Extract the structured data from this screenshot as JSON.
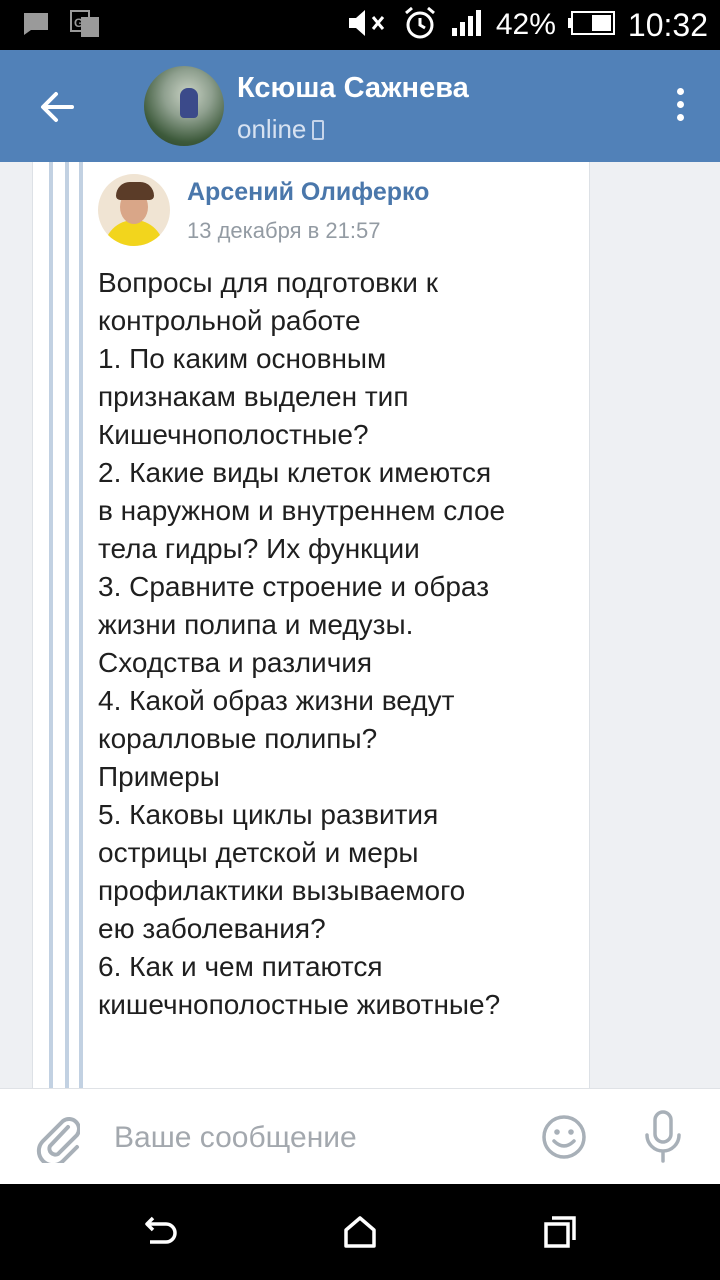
{
  "status_bar": {
    "battery_percent": "42%",
    "time": "10:32",
    "icons": [
      "message-icon",
      "translate-icon",
      "mute-icon",
      "alarm-icon",
      "signal-icon",
      "battery-icon"
    ]
  },
  "header": {
    "contact_name": "Ксюша Сажнева",
    "status": "online",
    "icons": [
      "back-arrow-icon",
      "mobile-icon",
      "more-vert-icon"
    ]
  },
  "forwarded_message": {
    "author": "Арсений Олиферко",
    "date": "13 декабря в 21:57",
    "lines": [
      "Вопросы для подготовки к",
      "контрольной работе",
      "1. По каким основным",
      "признакам выделен тип",
      "Кишечнополостные?",
      "2. Какие виды клеток имеются",
      "в наружном и внутреннем слое",
      "тела гидры? Их функции",
      "3. Сравните строение и образ",
      "жизни полипа и медузы.",
      "Сходства и различия",
      "4. Какой образ жизни ведут",
      "коралловые полипы?",
      "Примеры",
      "5. Каковы циклы развития",
      "острицы детской и меры",
      "профилактики вызываемого",
      "ею заболевания?",
      "6. Как и чем питаются",
      "кишечнополостные животные?"
    ]
  },
  "composer": {
    "placeholder": "Ваше сообщение",
    "value": "",
    "icons": [
      "paperclip-icon",
      "smile-icon",
      "microphone-icon"
    ]
  },
  "nav_bar": {
    "icons": [
      "nav-back-icon",
      "nav-home-icon",
      "nav-recent-icon"
    ]
  },
  "colors": {
    "header_bg": "#5181b8",
    "author_name": "#4a77ab",
    "quote_line": "#c2d1e2",
    "background": "#eef0f3"
  }
}
